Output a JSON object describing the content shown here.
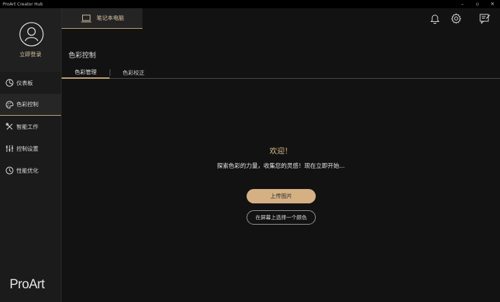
{
  "window": {
    "title": "ProArt Creator Hub",
    "controls": {
      "minimize": "–",
      "maximize": "▫",
      "close": "✕"
    }
  },
  "profile": {
    "login_label": "立即登录"
  },
  "sidebar": {
    "items": [
      {
        "label": "仪表板",
        "icon": "dashboard-icon"
      },
      {
        "label": "色彩控制",
        "icon": "palette-icon",
        "active": true
      },
      {
        "label": "智能工作",
        "icon": "tools-icon"
      },
      {
        "label": "控制设置",
        "icon": "sliders-icon"
      },
      {
        "label": "性能优化",
        "icon": "performance-icon"
      }
    ],
    "brand": "ProArt"
  },
  "header": {
    "device_tab": {
      "label": "笔记本电脑",
      "icon": "laptop-icon"
    },
    "icons": [
      "bell-icon",
      "gear-icon",
      "feedback-icon"
    ]
  },
  "main": {
    "title": "色彩控制",
    "tabs": [
      {
        "label": "色彩管理",
        "active": true
      },
      {
        "label": "色彩校正",
        "active": false
      }
    ],
    "welcome": "欢迎！",
    "subtitle": "探索色彩的力量，收集您的灵感！现在立即开始...",
    "upload_button": "上传图片",
    "pick_color_button": "在屏幕上选择一个颜色"
  },
  "colors": {
    "accent": "#c9a878",
    "primary_button": "#d4b083",
    "background": "#121212",
    "sidebar": "#1b1b1b"
  }
}
